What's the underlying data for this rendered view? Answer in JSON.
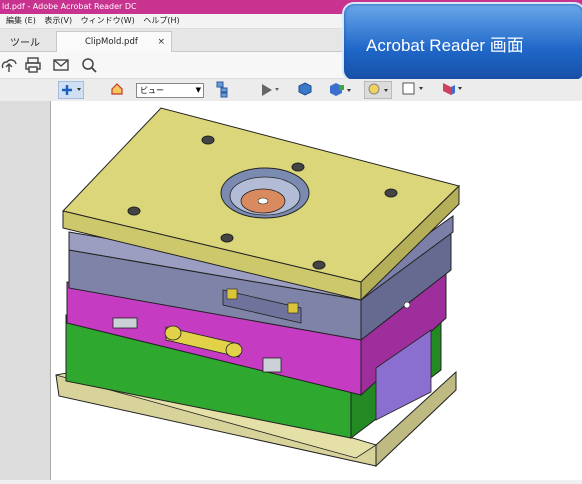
{
  "window": {
    "title": "ld.pdf - Adobe Acrobat Reader DC"
  },
  "menu": {
    "items": [
      "編集 (E)",
      "表示(V)",
      "ウィンドウ(W)",
      "ヘルプ(H)"
    ]
  },
  "tabs": {
    "tools_label": "ツール",
    "doc_label": "ClipMold.pdf",
    "close_glyph": "×"
  },
  "overlay": {
    "label": "Acrobat Reader 画面"
  },
  "toolbar2": {
    "view_select_value": "ビュー"
  },
  "colors": {
    "titlebar": "#c8338f",
    "overlay_blue": "#1f67c8",
    "top_plate": "#dbd67a",
    "purple": "#c53bc2",
    "green": "#2fa02f",
    "blue_gray": "#8083a8"
  }
}
